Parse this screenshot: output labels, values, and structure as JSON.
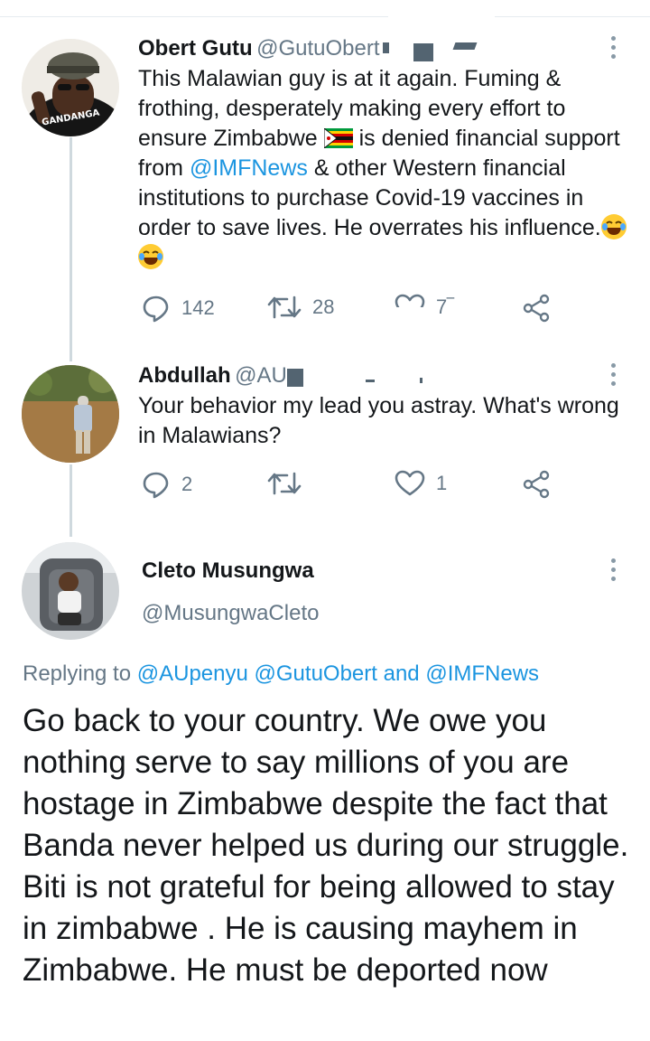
{
  "tweets": [
    {
      "name": "Obert Gutu",
      "handle": "@GutuObert",
      "avatar_text": "GANDANGA",
      "text_parts": {
        "p1": "This Malawian guy is at it again. Fuming & frothing, desperately making every effort to ensure Zimbabwe ",
        "p2": " is denied financial support from ",
        "mention": "@IMFNews",
        "p3": " & other Western financial institutions to purchase Covid-19 vaccines in order to save lives. He overrates his influence."
      },
      "replies": "142",
      "retweets": "28",
      "likes": "7‾"
    },
    {
      "name": "Abdullah",
      "handle": "@AUp",
      "text": "Your behavior my lead you astray. What's wrong in  Malawians?",
      "replies": "2",
      "retweets": "",
      "likes": "1"
    }
  ],
  "main_tweet": {
    "name": "Cleto Musungwa",
    "handle": "@MusungwaCleto",
    "replying_label": "Replying to",
    "reply_mentions": [
      "@AUpenyu",
      "@GutuObert",
      "@IMFNews"
    ],
    "and_word": "and",
    "text": "Go back to your country. We owe you nothing serve to say millions of you are hostage in Zimbabwe despite the fact that Banda never helped us during our struggle. Biti is not grateful for being allowed to stay in zimbabwe . He is causing mayhem in Zimbabwe. He must be deported now"
  },
  "colors": {
    "link": "#1b95e0",
    "secondary": "#657786",
    "text": "#14171a"
  },
  "icons": [
    "reply-icon",
    "retweet-icon",
    "like-icon",
    "share-icon",
    "more-icon"
  ]
}
